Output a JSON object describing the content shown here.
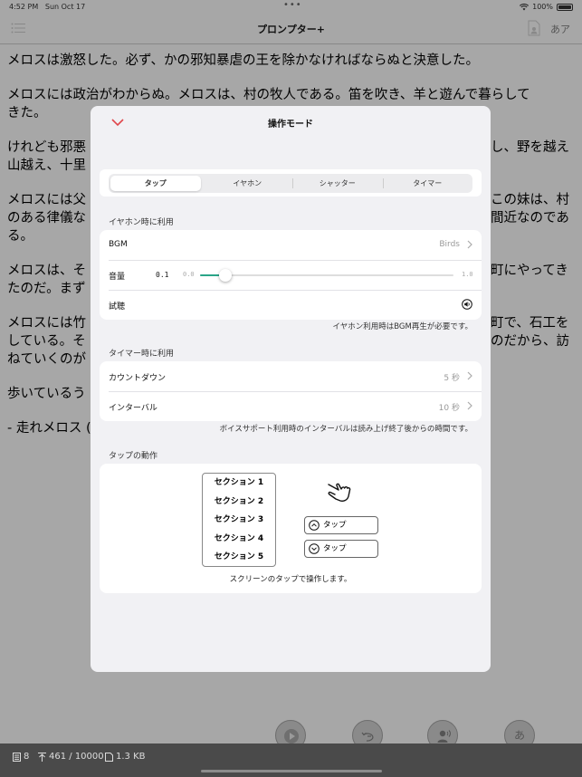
{
  "status": {
    "time": "4:52 PM",
    "date": "Sun Oct 17",
    "battery": "100%"
  },
  "navbar": {
    "title": "プロンプター+",
    "font_button": "あア"
  },
  "document": {
    "paragraphs": [
      "メロスは激怒した。必ず、かの邪知暴虐の王を除かなければならぬと決意した。",
      "メロスには政治がわからぬ。メロスは、村の牧人である。笛を吹き、羊と遊んで暮らして\nきた。",
      "けれども邪悪",
      "し、野を越え",
      "山越え、十里",
      "メロスには父",
      "この妹は、村",
      "のある律儀な",
      "間近なのであ",
      "る。",
      "メロスは、そ",
      "町にやってき",
      "たのだ。まず",
      "メロスには竹",
      "町で、石工を",
      "している。そ",
      "のだから、訪",
      "ねていくのが",
      "歩いているう",
      "- 走れメロス ("
    ]
  },
  "modal": {
    "title": "操作モード",
    "tabs": [
      "タップ",
      "イヤホン",
      "シャッター",
      "タイマー"
    ],
    "earphone": {
      "section_label": "イヤホン時に利用",
      "bgm_label": "BGM",
      "bgm_value": "Birds",
      "volume_label": "音量",
      "volume_value": "0.1",
      "volume_min": "0.0",
      "volume_max": "1.0",
      "volume_level": 0.1,
      "preview_label": "試聴",
      "footnote": "イヤホン利用時はBGM再生が必要です。"
    },
    "timer": {
      "section_label": "タイマー時に利用",
      "countdown_label": "カウントダウン",
      "countdown_value": "5 秒",
      "interval_label": "インターバル",
      "interval_value": "10 秒",
      "footnote": "ボイスサポート利用時のインターバルは読み上げ終了後からの時間です。"
    },
    "tap": {
      "section_label": "タップの動作",
      "sections": [
        "セクション 1",
        "セクション 2",
        "セクション 3",
        "セクション 4",
        "セクション 5"
      ],
      "up_button": "タップ",
      "down_button": "タップ",
      "caption": "スクリーンのタップで操作します。"
    }
  },
  "controls": {
    "font_glyph": "あ"
  },
  "bottombar": {
    "sections": "8",
    "position": "461 / 10000",
    "size": "1.3 KB"
  }
}
